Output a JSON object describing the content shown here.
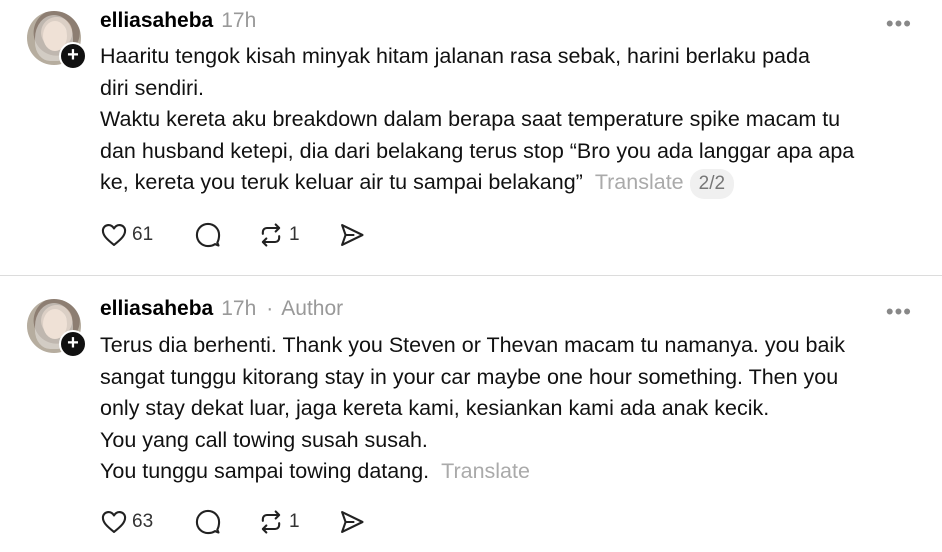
{
  "posts": [
    {
      "username": "elliasaheba",
      "time": "17h",
      "author_tag": "",
      "lines": [
        "Haaritu tengok kisah minyak hitam jalanan rasa sebak, harini berlaku pada",
        "diri sendiri.",
        "Waktu kereta aku breakdown dalam berapa saat temperature spike macam tu",
        "dan husband ketepi, dia dari belakang terus stop “Bro you ada langgar apa apa",
        "ke, kereta you teruk keluar air tu sampai belakang”"
      ],
      "translate_label": "Translate",
      "pager": "2/2",
      "likes": "61",
      "reposts": "1"
    },
    {
      "username": "elliasaheba",
      "time": "17h",
      "separator": "·",
      "author_tag": "Author",
      "lines": [
        "Terus dia berhenti. Thank you Steven or Thevan macam tu namanya. you baik",
        "sangat tunggu kitorang stay in your car maybe one hour something. Then you",
        "only stay dekat luar, jaga kereta kami, kesiankan kami ada anak kecik.",
        "You yang call towing susah susah.",
        "You tunggu sampai towing datang."
      ],
      "translate_label": "Translate",
      "likes": "63",
      "reposts": "1"
    }
  ],
  "icons": {
    "like": "heart-icon",
    "reply": "comment-bubble-icon",
    "repost": "repost-icon",
    "share": "send-icon",
    "more": "more-dots-icon",
    "follow": "plus-icon"
  },
  "more_label": "•••",
  "follow_label": "+"
}
